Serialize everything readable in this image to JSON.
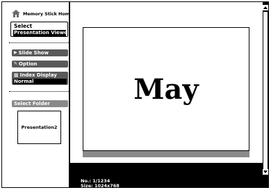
{
  "home": {
    "label": "Memory Stick Home",
    "icon": "house-icon"
  },
  "select": {
    "title": "Select",
    "value": "Presentation Viewer"
  },
  "menu": {
    "slide_show": {
      "label": "Slide Show",
      "icon": "slideshow-icon"
    },
    "option": {
      "label": "Option",
      "icon": "option-icon"
    },
    "index_display": {
      "label": "Index Display",
      "value": "Normal",
      "icon": "grid-icon"
    }
  },
  "folder": {
    "button_label": "Select Folder",
    "thumbnail_label": "Presentation2"
  },
  "viewer": {
    "slide_text": "May",
    "info_no": "No.: 1/1234",
    "info_size": "Size: 1024x768"
  },
  "colors": {
    "accent_dark": "#000000",
    "button_gray": "#5a5a5a",
    "folder_gray": "#8a8a8a"
  }
}
